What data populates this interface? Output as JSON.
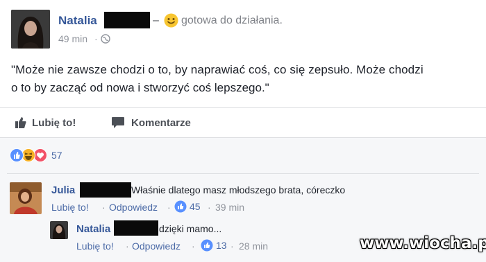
{
  "post": {
    "author": "Natalia",
    "dash": "–",
    "feeling_emoji_icon": "smiling-emoji-icon",
    "feeling": "gotowa do działania.",
    "time": "49 min",
    "separator": "·",
    "privacy_icon": "globe-icon",
    "text_line1": "\"Może nie zawsze chodzi o to, by naprawiać coś, co się zepsuło. Może chodzi",
    "text_line2": "o to by zacząć od nowa i stworzyć coś lepszego.\""
  },
  "actions": {
    "like_label": "Lubię to!",
    "comment_label": "Komentarze"
  },
  "reactions": {
    "count": "57",
    "icons": [
      "like-reaction-icon",
      "haha-reaction-icon",
      "love-reaction-icon"
    ]
  },
  "comments": [
    {
      "author": "Julia",
      "text": "Właśnie dlatego masz młodszego brata, córeczko",
      "like_label": "Lubię to!",
      "dot": "·",
      "reply_label": "Odpowiedz",
      "likes": "45",
      "time": "39 min"
    },
    {
      "author": "Natalia",
      "text": "dzięki mamo...",
      "like_label": "Lubię to!",
      "dot": "·",
      "reply_label": "Odpowiedz",
      "likes": "13",
      "time": "28 min"
    }
  ],
  "watermark": "www.wiocha.pl",
  "colors": {
    "name_blue": "#365899",
    "link_blue": "#4b6aa6",
    "muted_gray": "#90949c",
    "footer_bg": "#f6f7f9",
    "like_blue": "#5890ff",
    "love_red": "#f25268",
    "haha_yellow": "#f7b125"
  }
}
